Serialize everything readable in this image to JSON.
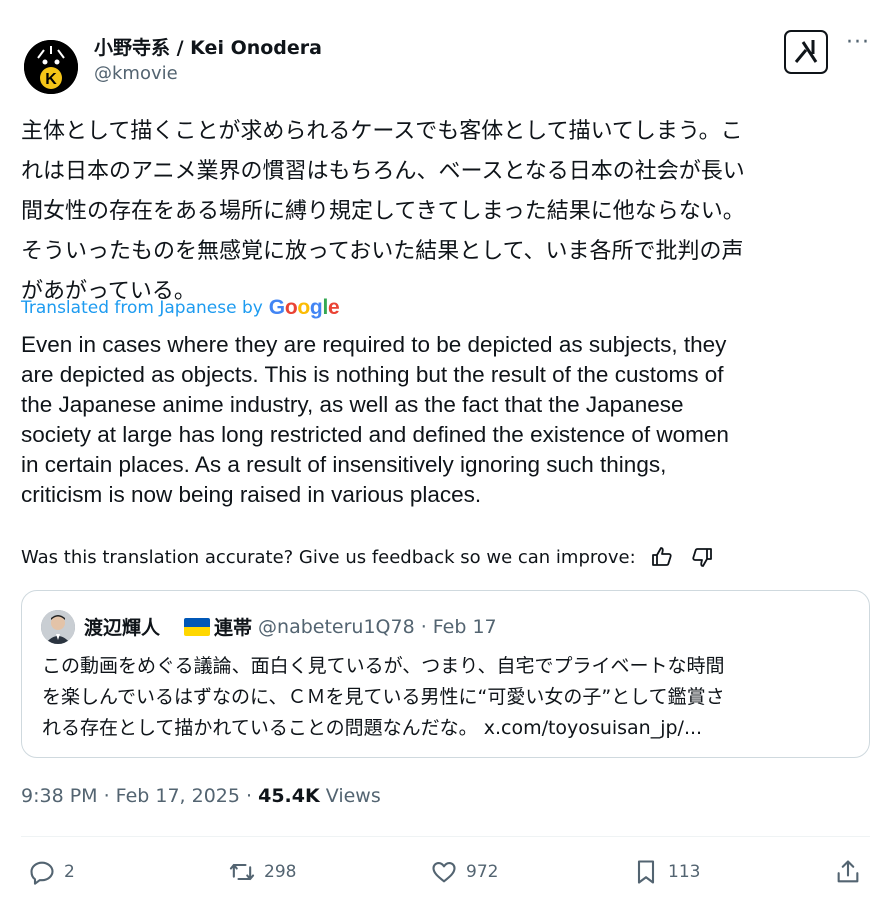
{
  "author": {
    "display_name": "小野寺系 / Kei Onodera",
    "handle": "@kmovie",
    "avatar_icon": "avatar-k-icon"
  },
  "header_icons": [
    "grok-icon",
    "more-icon"
  ],
  "post": {
    "text_jp": "主体として描くことが求められるケースでも客体として描いてしまう。こ\nれは日本のアニメ業界の慣習はもちろん、ベースとなる日本の社会が長い\n間女性の存在をある場所に縛り規定してきてしまった結果に他ならない。\nそういったものを無感覚に放っておいた結果として、いま各所で批判の声\nがあがっている。",
    "translated_label": "Translated from Japanese by",
    "translator_brand": "Google",
    "text_en": "Even in cases where they are required to be depicted as subjects, they\nare depicted as objects. This is nothing but the result of the customs of\nthe Japanese anime industry, as well as the fact that the Japanese\nsociety at large has long restricted and defined the existence of women\nin certain places. As a result of insensitively ignoring such things,\ncriticism is now being raised in various places.",
    "feedback_text": "Was this translation accurate? Give us feedback so we can improve:"
  },
  "quote": {
    "name": "渡辺輝人",
    "flag_label": "連帯",
    "handle": "@nabeteru1Q78",
    "date": "· Feb 17",
    "text": "この動画をめぐる議論、面白く見ているが、つまり、自宅でプライベートな時間\nを楽しんでいるはずなのに、ＣＭを見ている男性に“可愛い女の子”として鑑賞さ\nれる存在として描かれていることの問題なんだな。 x.com/toyosuisan_jp/..."
  },
  "meta": {
    "time": "9:38 PM · Feb 17, 2025 · ",
    "views_count": "45.4K",
    "views_label": " Views"
  },
  "actions": {
    "replies": "2",
    "reposts": "298",
    "likes": "972",
    "bookmarks": "113"
  },
  "colors": {
    "link": "#1d9bf0",
    "muted": "#536471",
    "text": "#0f1419"
  }
}
